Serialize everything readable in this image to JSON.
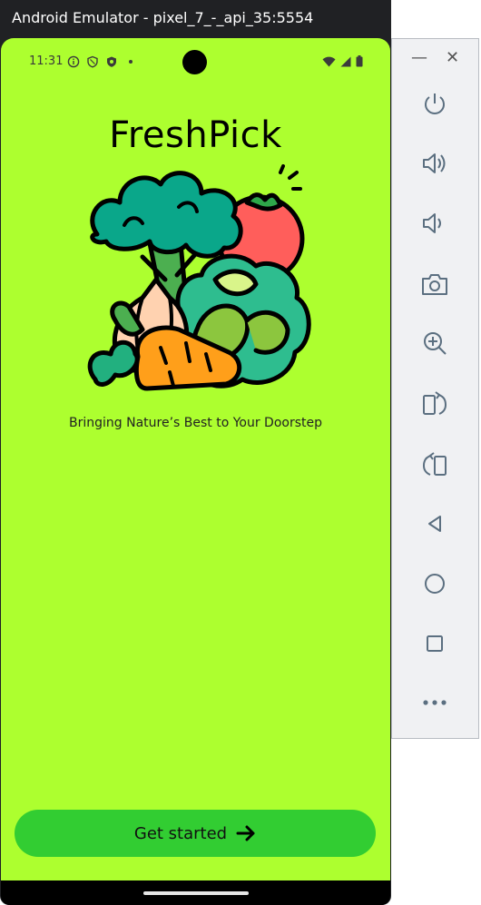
{
  "window": {
    "title": "Android Emulator - pixel_7_-_api_35:5554"
  },
  "status_bar": {
    "time": "11:31"
  },
  "app": {
    "title": "FreshPick",
    "tagline": "Bringing Nature’s Best to Your Doorstep",
    "cta_label": "Get started",
    "illustration": "vegetables-illustration"
  },
  "colors": {
    "background": "#adff2f",
    "button": "#32cd32",
    "panel": "#f0f1f3",
    "icon": "#5b6f80"
  },
  "side_toolbar": {
    "controls": [
      "minimize",
      "close"
    ],
    "tools": [
      "power",
      "volume-up",
      "volume-down",
      "camera",
      "zoom",
      "rotate-left",
      "rotate-right",
      "back",
      "home",
      "overview",
      "more"
    ]
  }
}
